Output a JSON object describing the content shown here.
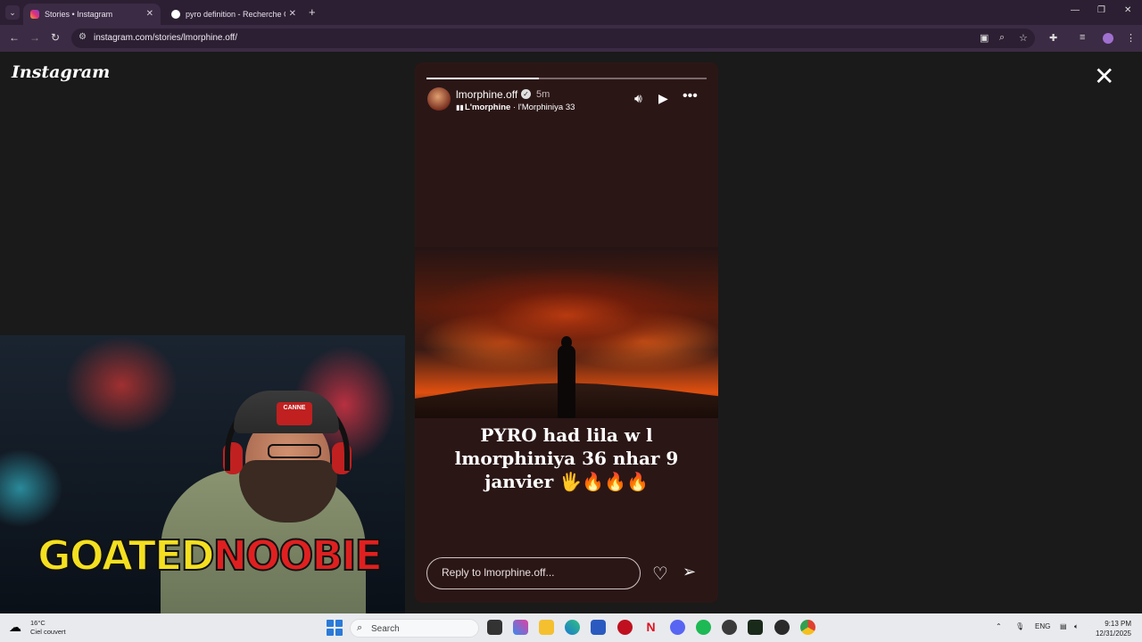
{
  "browser": {
    "tabs": [
      {
        "title": "Stories • Instagram",
        "active": true
      },
      {
        "title": "pyro definition - Recherche Go",
        "active": false
      }
    ],
    "url": "instagram.com/stories/lmorphine.off/"
  },
  "instagram": {
    "logo": "Instagram",
    "story": {
      "username": "lmorphine.off",
      "time_ago": "5m",
      "music_artist": "L'morphine",
      "music_separator": " · ",
      "music_title": "l'Morphiniya 33",
      "progress": 0.4,
      "caption": "PYRO had lila w l lmorphiniya 36 nhar 9 janvier 🖐🔥🔥🔥",
      "reply_placeholder": "Reply to lmorphine.off..."
    }
  },
  "overlay": {
    "brand_left": "GOATED",
    "brand_right": "NOOBIE",
    "cap_text": "CANNE"
  },
  "taskbar": {
    "weather_temp": "16°C",
    "weather_desc": "Ciel couvert",
    "search_label": "Search",
    "language": "ENG",
    "time": "9:13 PM",
    "date": "12/31/2025"
  },
  "colors": {
    "accent": "#3c2b44",
    "story_bg": "#2b1616",
    "brand_yellow": "#f4e020",
    "brand_red": "#e02020"
  }
}
